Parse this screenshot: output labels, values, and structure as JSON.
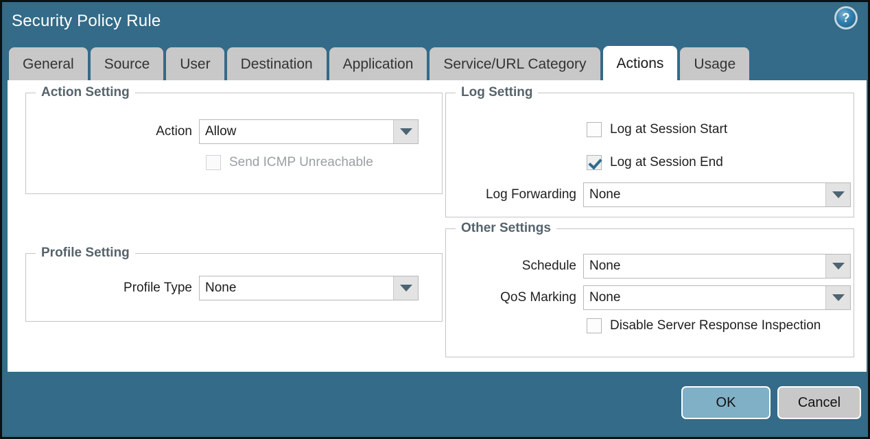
{
  "window": {
    "title": "Security Policy Rule",
    "help_icon": "help-circle-icon",
    "accent_color": "#336b88",
    "tab_inactive_color": "#c8c8c8",
    "tab_active_color": "#ffffff"
  },
  "tabs": [
    {
      "label": "General",
      "active": false
    },
    {
      "label": "Source",
      "active": false
    },
    {
      "label": "User",
      "active": false
    },
    {
      "label": "Destination",
      "active": false
    },
    {
      "label": "Application",
      "active": false
    },
    {
      "label": "Service/URL Category",
      "active": false
    },
    {
      "label": "Actions",
      "active": true
    },
    {
      "label": "Usage",
      "active": false
    }
  ],
  "action_setting": {
    "legend": "Action Setting",
    "action_label": "Action",
    "action_value": "Allow",
    "send_icmp_label": "Send ICMP Unreachable",
    "send_icmp_checked": false,
    "send_icmp_disabled": true
  },
  "profile_setting": {
    "legend": "Profile Setting",
    "profile_type_label": "Profile Type",
    "profile_type_value": "None"
  },
  "log_setting": {
    "legend": "Log Setting",
    "log_start_label": "Log at Session Start",
    "log_start_checked": false,
    "log_end_label": "Log at Session End",
    "log_end_checked": true,
    "log_forwarding_label": "Log Forwarding",
    "log_forwarding_value": "None"
  },
  "other_settings": {
    "legend": "Other Settings",
    "schedule_label": "Schedule",
    "schedule_value": "None",
    "qos_label": "QoS Marking",
    "qos_value": "None",
    "disable_inspection_label": "Disable Server Response Inspection",
    "disable_inspection_checked": false
  },
  "footer": {
    "ok_label": "OK",
    "cancel_label": "Cancel",
    "ok_color": "#7fb0c6",
    "cancel_color": "#c8c8c8"
  }
}
